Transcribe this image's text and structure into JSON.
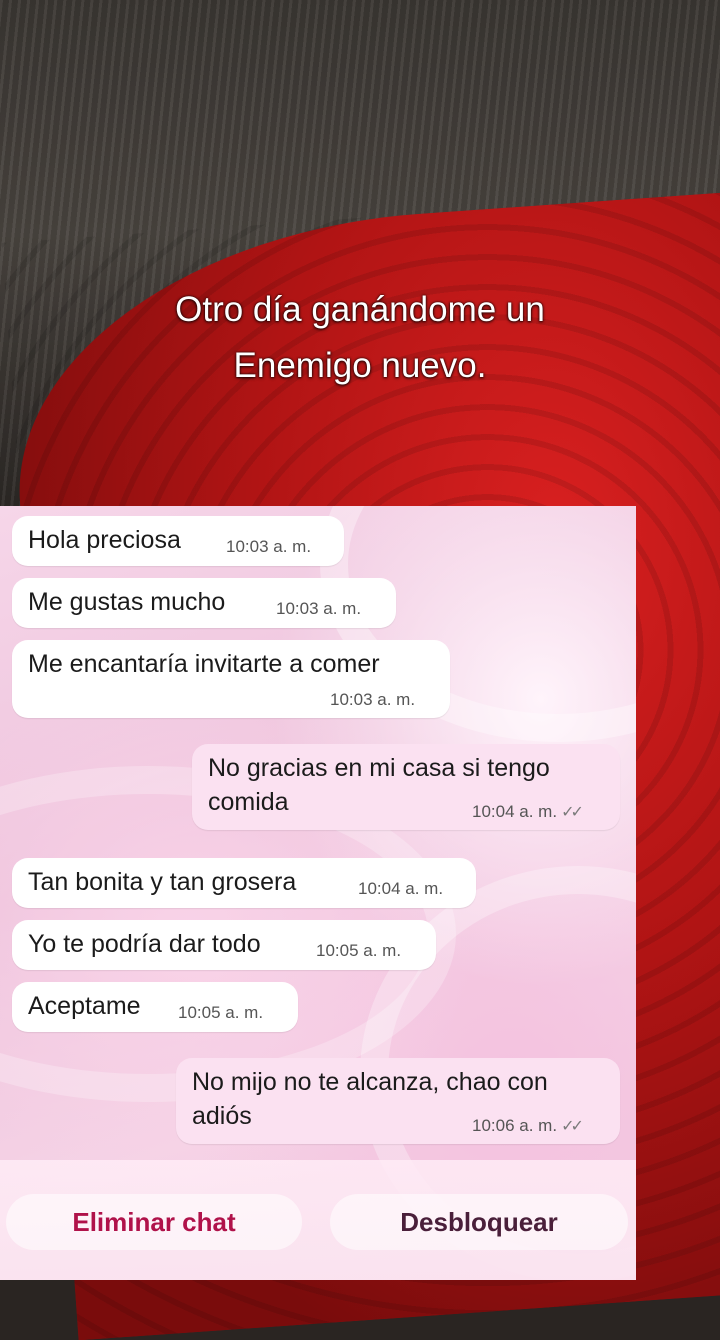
{
  "caption": {
    "line1": "Otro día ganándome un",
    "line2": "Enemigo nuevo."
  },
  "messages": [
    {
      "direction": "in",
      "text": "Hola preciosa",
      "time": "10:03 a. m."
    },
    {
      "direction": "in",
      "text": "Me gustas mucho",
      "time": "10:03 a. m."
    },
    {
      "direction": "in",
      "text": "Me encantaría invitarte a comer",
      "time": "10:03 a. m."
    },
    {
      "direction": "out",
      "text_line1": "No gracias en mi casa si tengo",
      "text_line2": "comida",
      "time": "10:04 a. m.",
      "status": "read"
    },
    {
      "direction": "in",
      "text": "Tan bonita y tan grosera",
      "time": "10:04 a. m."
    },
    {
      "direction": "in",
      "text": "Yo te podría dar todo",
      "time": "10:05 a. m."
    },
    {
      "direction": "in",
      "text": "Aceptame",
      "time": "10:05 a. m."
    },
    {
      "direction": "out",
      "text_line1": "No mijo no te alcanza, chao con",
      "text_line2": "adiós",
      "time": "10:06 a. m.",
      "status": "read"
    }
  ],
  "actions": {
    "delete_label": "Eliminar chat",
    "unblock_label": "Desbloquear"
  },
  "colors": {
    "delete_accent": "#b0124a",
    "unblock_text": "#4a1f3a",
    "outgoing_bubble": "#fbe1f1",
    "incoming_bubble": "#ffffff"
  },
  "icons": {
    "read_status": "double-check-icon"
  }
}
